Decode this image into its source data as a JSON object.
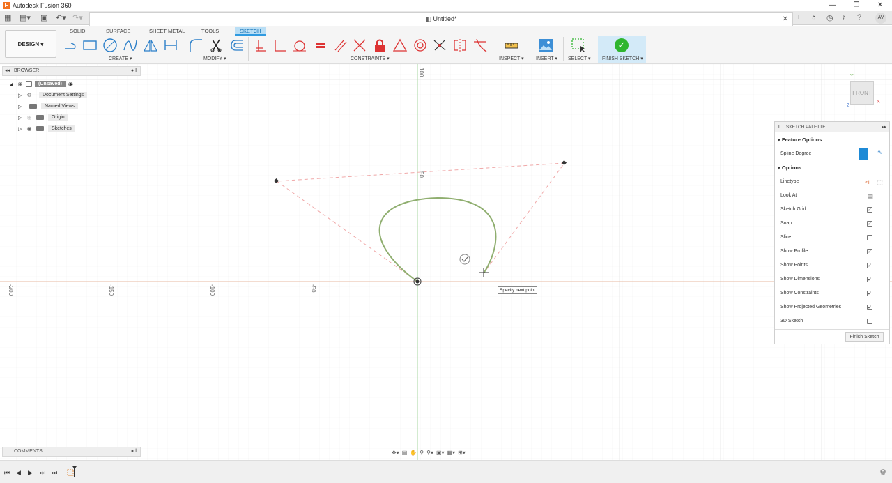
{
  "app": {
    "title": "Autodesk Fusion 360",
    "doc_title": "Untitled*",
    "user_initials": "AV"
  },
  "ribbon": {
    "workspace_label": "DESIGN ▾",
    "tabs": [
      "SOLID",
      "SURFACE",
      "SHEET METAL",
      "TOOLS",
      "SKETCH"
    ],
    "active_tab": "SKETCH",
    "groups": {
      "create": "CREATE ▾",
      "modify": "MODIFY ▾",
      "constraints": "CONSTRAINTS ▾",
      "inspect": "INSPECT ▾",
      "insert": "INSERT ▾",
      "select": "SELECT ▾",
      "finish": "FINISH SKETCH ▾"
    }
  },
  "browser": {
    "title": "BROWSER",
    "items": [
      {
        "label": "(Unsaved)"
      },
      {
        "label": "Document Settings"
      },
      {
        "label": "Named Views"
      },
      {
        "label": "Origin"
      },
      {
        "label": "Sketches"
      }
    ]
  },
  "comments": {
    "title": "COMMENTS"
  },
  "palette": {
    "title": "SKETCH PALETTE",
    "feature_options": "Feature Options",
    "spline_degree": "Spline Degree",
    "options": "Options",
    "rows": [
      {
        "label": "Linetype",
        "type": "icon"
      },
      {
        "label": "Look At",
        "type": "icon"
      },
      {
        "label": "Sketch Grid",
        "checked": true
      },
      {
        "label": "Snap",
        "checked": true
      },
      {
        "label": "Slice",
        "checked": false
      },
      {
        "label": "Show Profile",
        "checked": true
      },
      {
        "label": "Show Points",
        "checked": true
      },
      {
        "label": "Show Dimensions",
        "checked": true
      },
      {
        "label": "Show Constraints",
        "checked": true
      },
      {
        "label": "Show Projected Geometries",
        "checked": true
      },
      {
        "label": "3D Sketch",
        "checked": false
      }
    ],
    "finish_button": "Finish Sketch"
  },
  "viewcube": {
    "face": "FRONT",
    "x": "X",
    "y": "Y",
    "z": "Z"
  },
  "canvas": {
    "tooltip": "Specify next point",
    "rulers_horizontal": [
      "-200",
      "-150",
      "-100",
      "-50"
    ],
    "rulers_vertical": [
      "100",
      "50"
    ]
  },
  "colors": {
    "accent": "#2f9ae0",
    "finish_green": "#2fb52f",
    "spline": "#8fae6f",
    "control_line": "#f0a8a8",
    "axis_x": "#e7b9a0",
    "axis_y": "#a7d7a0"
  }
}
